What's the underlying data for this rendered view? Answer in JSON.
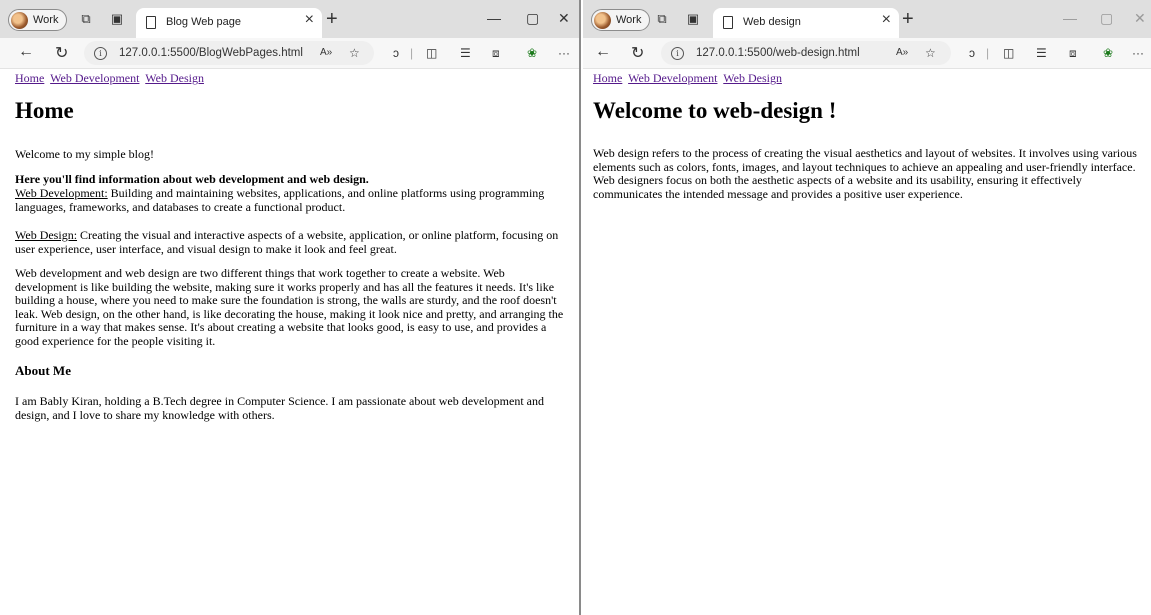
{
  "left": {
    "profile_label": "Work",
    "tab_title": "Blog Web page",
    "url": "127.0.0.1:5500/BlogWebPages.html",
    "nav_links": [
      "Home",
      "Web Development",
      "Web Design"
    ],
    "page_title": "Home",
    "welcome": "Welcome to my simple blog!",
    "info_heading": "Here you'll find information about web development and web design.",
    "webdev_label": "Web Development:",
    "webdev_text": " Building and maintaining websites, applications, and online platforms using programming languages, frameworks, and databases to create a functional product.",
    "webdesign_label": "Web Design:",
    "webdesign_text": " Creating the visual and interactive aspects of a website, application, or online platform, focusing on user experience, user interface, and visual design to make it look and feel great.",
    "comparison": "Web development and web design are two different things that work together to create a website. Web development is like building the website, making sure it works properly and has all the features it needs. It's like building a house, where you need to make sure the foundation is strong, the walls are sturdy, and the roof doesn't leak. Web design, on the other hand, is like decorating the house, making it look nice and pretty, and arranging the furniture in a way that makes sense. It's about creating a website that looks good, is easy to use, and provides a good experience for the people visiting it.",
    "about_heading": "About Me",
    "about_text": "I am Bably Kiran, holding a B.Tech degree in Computer Science. I am passionate about web development and design, and I love to share my knowledge with others."
  },
  "right": {
    "profile_label": "Work",
    "tab_title": "Web design",
    "url": "127.0.0.1:5500/web-design.html",
    "nav_links": [
      "Home",
      "Web Development",
      "Web Design"
    ],
    "page_title": "Welcome to web-design !",
    "body": "Web design refers to the process of creating the visual aesthetics and layout of websites. It involves using various elements such as colors, fonts, images, and layout techniques to achieve an appealing and user-friendly interface. Web designers focus on both the aesthetic aspects of a website and its usability, ensuring it effectively communicates the intended message and provides a positive user experience."
  },
  "icons": [
    "avatar-icon",
    "workspaces-icon",
    "tab-actions-icon",
    "page-icon",
    "close-icon",
    "new-tab-icon",
    "minimize-icon",
    "maximize-icon",
    "back-icon",
    "refresh-icon",
    "info-icon",
    "read-aloud-icon",
    "favorite-icon",
    "copilot-icon",
    "split-screen-icon",
    "favorites-icon",
    "collections-icon",
    "extensions-icon",
    "more-icon"
  ]
}
